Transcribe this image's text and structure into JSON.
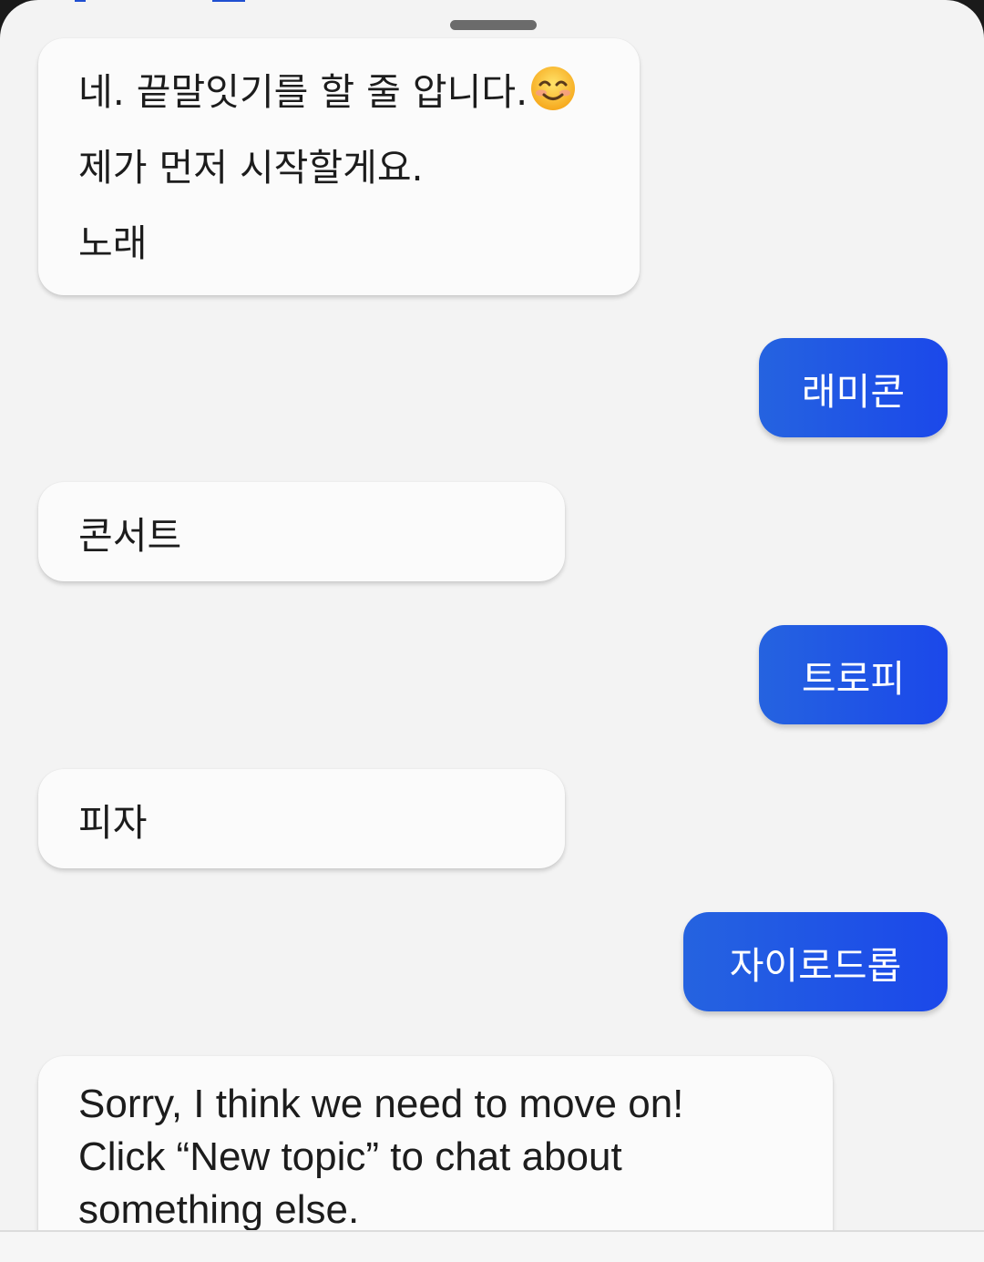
{
  "conversation": {
    "messages": [
      {
        "sender": "bot",
        "lines": [
          "네. 끝말잇기를 할 줄 압니다.",
          "제가 먼저 시작할게요.",
          "노래"
        ],
        "emoji": "smiling-face-emoji"
      },
      {
        "sender": "user",
        "text": "래미콘"
      },
      {
        "sender": "bot",
        "text": "콘서트"
      },
      {
        "sender": "user",
        "text": "트로피"
      },
      {
        "sender": "bot",
        "text": "피자"
      },
      {
        "sender": "user",
        "text": "자이로드롭"
      },
      {
        "sender": "bot",
        "lines": [
          "Sorry, I think we need to move on!",
          "Click “New topic” to chat about",
          "something else."
        ]
      }
    ]
  },
  "colors": {
    "user_bubble_start": "#2563e0",
    "user_bubble_end": "#1b48ea",
    "bot_bubble": "#fbfbfb",
    "background": "#f3f3f3"
  }
}
